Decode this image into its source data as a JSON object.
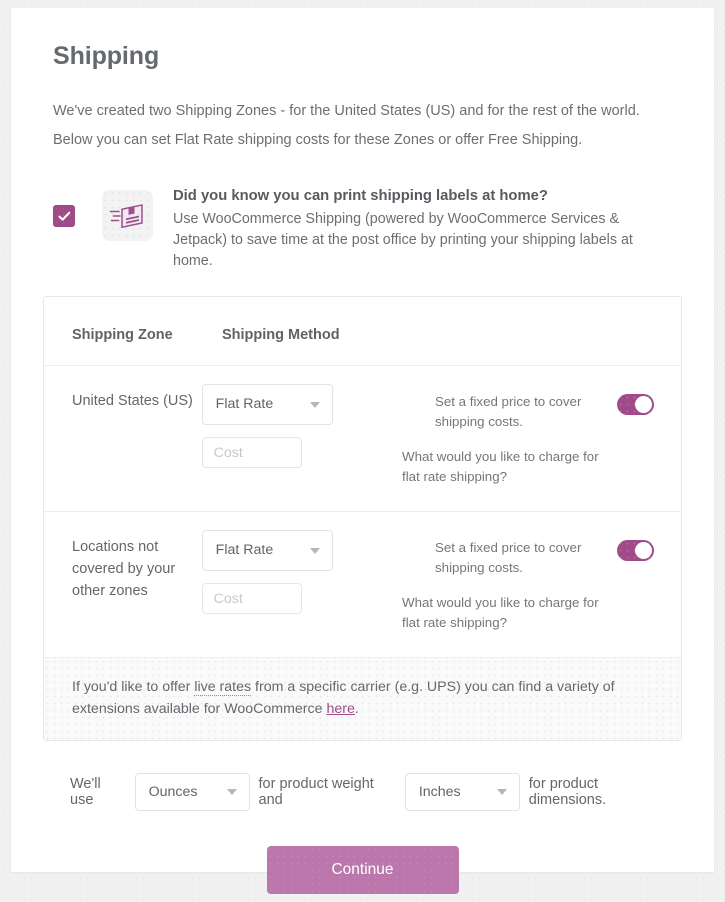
{
  "page": {
    "title": "Shipping",
    "intro": "We've created two Shipping Zones - for the United States (US) and for the rest of the world. Below you can set Flat Rate shipping costs for these Zones or offer Free Shipping."
  },
  "promo": {
    "checkbox_checked": true,
    "icon_name": "shipping-label-package-icon",
    "heading": "Did you know you can print shipping labels at home?",
    "body": "Use WooCommerce Shipping (powered by WooCommerce Services & Jetpack) to save time at the post office by printing your shipping labels at home."
  },
  "zones_table": {
    "headers": {
      "zone": "Shipping Zone",
      "method": "Shipping Method"
    },
    "rows": [
      {
        "zone": "United States (US)",
        "method_value": "Flat Rate",
        "cost_value": "",
        "cost_placeholder": "Cost",
        "method_description": "Set a fixed price to cover shipping costs.",
        "cost_description": "What would you like to charge for flat rate shipping?",
        "enabled": true
      },
      {
        "zone": "Locations not covered by your other zones",
        "method_value": "Flat Rate",
        "cost_value": "",
        "cost_placeholder": "Cost",
        "method_description": "Set a fixed price to cover shipping costs.",
        "cost_description": "What would you like to charge for flat rate shipping?",
        "enabled": true
      }
    ],
    "notice": {
      "part1": "If you'd like to offer ",
      "link1": "live rates",
      "part2": " from a specific carrier (e.g. UPS) you can find a variety of extensions available for WooCommerce ",
      "link2": "here",
      "part3": "."
    }
  },
  "units": {
    "prefix": "We'll use",
    "weight_value": "Ounces",
    "middle": "for product weight and",
    "dimension_value": "Inches",
    "suffix": "for product dimensions."
  },
  "footer": {
    "continue_label": "Continue"
  },
  "colors": {
    "accent": "#a04a8a",
    "button": "#bb77ac",
    "text": "#63676b",
    "heading": "#666a6e"
  }
}
